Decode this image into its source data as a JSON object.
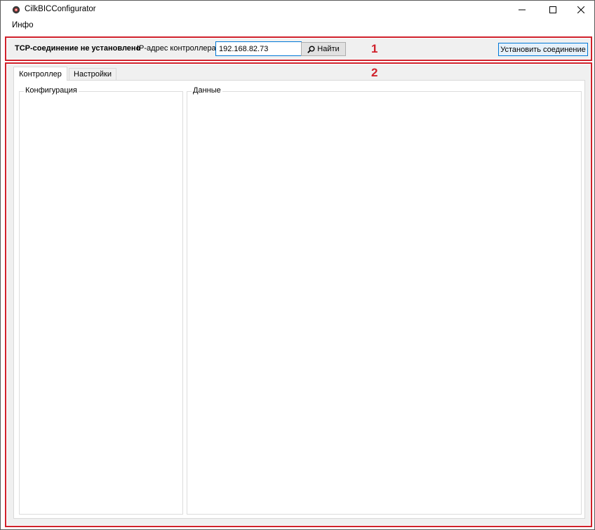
{
  "window": {
    "title": "CilkBICConfigurator",
    "controls": [
      "minimize",
      "maximize",
      "close"
    ]
  },
  "menu": {
    "items": [
      {
        "label": "Инфо"
      }
    ]
  },
  "annotations": {
    "label_1": "1",
    "label_2": "2",
    "color": "#d0212b"
  },
  "connection": {
    "status": "TCP-соединение не установлено",
    "ip_label": "IP-адрес контроллера:",
    "ip_value": "192.168.82.73",
    "find_button": "Найти",
    "connect_button": "Установить соединение"
  },
  "tabs": [
    {
      "label": "Контроллер",
      "active": true
    },
    {
      "label": "Настройки",
      "active": false
    }
  ],
  "panels": {
    "config_title": "Конфигурация",
    "data_title": "Данные"
  },
  "colors": {
    "accent": "#0078d7",
    "annotation": "#d0212b",
    "toolbar_bg": "#f0f0f0"
  },
  "icons": {
    "app": "app-icon",
    "search": "search-icon"
  }
}
